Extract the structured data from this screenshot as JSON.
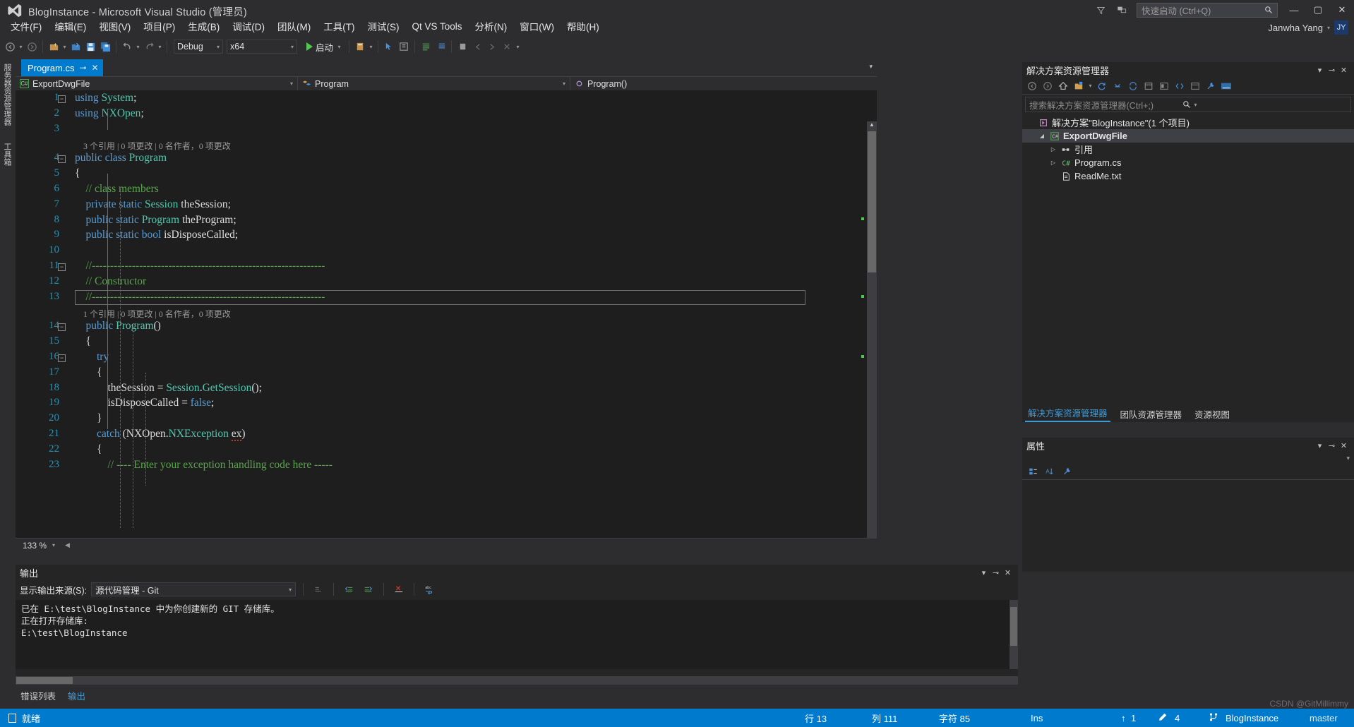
{
  "titlebar": {
    "title": "BlogInstance - Microsoft Visual Studio (管理员)",
    "quick_launch_placeholder": "快速启动 (Ctrl+Q)",
    "filter_icon": "funnel-icon",
    "feedback_icon": "feedback-icon",
    "search_icon": "search-icon",
    "minimize": "—",
    "maximize": "▢",
    "close": "✕",
    "account_name": "Janwha Yang",
    "account_caret": "▾",
    "avatar_initials": "JY"
  },
  "menubar": {
    "items": [
      {
        "label": "文件(F)"
      },
      {
        "label": "编辑(E)"
      },
      {
        "label": "视图(V)"
      },
      {
        "label": "项目(P)"
      },
      {
        "label": "生成(B)"
      },
      {
        "label": "调试(D)"
      },
      {
        "label": "团队(M)"
      },
      {
        "label": "工具(T)"
      },
      {
        "label": "测试(S)"
      },
      {
        "label": "Qt VS Tools"
      },
      {
        "label": "分析(N)"
      },
      {
        "label": "窗口(W)"
      },
      {
        "label": "帮助(H)"
      }
    ]
  },
  "toolbar": {
    "configuration": "Debug",
    "platform": "x64",
    "start_label": "启动",
    "caret": "▾"
  },
  "left_tabs": [
    {
      "label": "服务器资源管理器"
    },
    {
      "label": "工具箱"
    }
  ],
  "editor": {
    "tab": {
      "name": "Program.cs",
      "pin": "⊸",
      "close": "✕"
    },
    "breadcrumbs": {
      "project": "ExportDwgFile",
      "type": "Program",
      "member": "Program()",
      "caret": "▾"
    },
    "zoom_level": "133 %",
    "lines": [
      {
        "n": 1,
        "fold": "−",
        "text": "using System;"
      },
      {
        "n": 2,
        "fold": "",
        "text": "using NXOpen;"
      },
      {
        "n": 3,
        "fold": "",
        "text": ""
      },
      {
        "n": 4,
        "fold": "−",
        "text": "public class Program"
      },
      {
        "n": 5,
        "fold": "",
        "text": "{"
      },
      {
        "n": 6,
        "fold": "",
        "text": "    // class members"
      },
      {
        "n": 7,
        "fold": "",
        "text": "    private static Session theSession;"
      },
      {
        "n": 8,
        "fold": "",
        "text": "    public static Program theProgram;"
      },
      {
        "n": 9,
        "fold": "",
        "text": "    public static bool isDisposeCalled;"
      },
      {
        "n": 10,
        "fold": "",
        "text": ""
      },
      {
        "n": 11,
        "fold": "−",
        "text": "    //----------------------------------------------------------------"
      },
      {
        "n": 12,
        "fold": "",
        "text": "    // Constructor"
      },
      {
        "n": 13,
        "fold": "",
        "text": "    //----------------------------------------------------------------"
      },
      {
        "n": 14,
        "fold": "−",
        "text": "    public Program()"
      },
      {
        "n": 15,
        "fold": "",
        "text": "    {"
      },
      {
        "n": 16,
        "fold": "−",
        "text": "        try"
      },
      {
        "n": 17,
        "fold": "",
        "text": "        {"
      },
      {
        "n": 18,
        "fold": "",
        "text": "            theSession = Session.GetSession();"
      },
      {
        "n": 19,
        "fold": "",
        "text": "            isDisposeCalled = false;"
      },
      {
        "n": 20,
        "fold": "",
        "text": "        }"
      },
      {
        "n": 21,
        "fold": "",
        "text": "        catch (NXOpen.NXException ex)"
      },
      {
        "n": 22,
        "fold": "",
        "text": "        {"
      },
      {
        "n": 23,
        "fold": "",
        "text": "            // ---- Enter your exception handling code here -----"
      }
    ],
    "codelens": [
      {
        "after_line": 3,
        "text": "3 个引用 | 0 项更改 | 0 名作者，0 项更改"
      },
      {
        "after_line": 13,
        "text": "1 个引用 | 0 项更改 | 0 名作者，0 项更改"
      }
    ],
    "current_line": 13
  },
  "solution_explorer": {
    "title": "解决方案资源管理器",
    "caret_icon": "chevron-down-icon",
    "pin_icon": "pin-icon",
    "close_icon": "close-icon",
    "search_placeholder": "搜索解决方案资源管理器(Ctrl+;)",
    "search_icon": "search-icon",
    "search_caret": "▾",
    "toolbar_icons": [
      "back-icon",
      "forward-icon",
      "home-icon",
      "show-all-files-icon",
      "caret-icon",
      "refresh-icon",
      "collapse-all-icon",
      "sync-icon",
      "properties-icon",
      "preview-icon",
      "code-view-icon",
      "designer-icon",
      "wrench-icon",
      "pending-changes-icon"
    ],
    "tree": [
      {
        "indent": 0,
        "arrow": "",
        "icon": "solution-icon",
        "label": "解决方案\"BlogInstance\"(1 个项目)",
        "bold": false
      },
      {
        "indent": 1,
        "arrow": "◢",
        "icon": "csharp-project-icon",
        "label": "ExportDwgFile",
        "bold": true
      },
      {
        "indent": 2,
        "arrow": "▷",
        "icon": "references-icon",
        "label": "引用",
        "bold": false
      },
      {
        "indent": 2,
        "arrow": "▷",
        "icon": "csharp-file-icon",
        "label": "Program.cs",
        "bold": false
      },
      {
        "indent": 2,
        "arrow": "",
        "icon": "text-file-icon",
        "label": "ReadMe.txt",
        "bold": false
      }
    ],
    "tabs": [
      {
        "label": "解决方案资源管理器",
        "active": true
      },
      {
        "label": "团队资源管理器",
        "active": false
      },
      {
        "label": "资源视图",
        "active": false
      }
    ]
  },
  "properties": {
    "title": "属性",
    "caret_icon": "chevron-down-icon",
    "pin_icon": "pin-icon",
    "close_icon": "close-icon",
    "toolbar_icons": [
      "categorized-icon",
      "alphabetical-icon",
      "events-icon"
    ]
  },
  "output": {
    "title": "输出",
    "caret_icon": "chevron-down-icon",
    "pin_icon": "pin-icon",
    "close_icon": "close-icon",
    "source_label": "显示输出来源(S):",
    "source_value": "源代码管理 - Git",
    "source_caret": "▾",
    "toolbar_icons": [
      "clear-all-icon",
      "jump-prev-icon",
      "jump-next-icon",
      "clear-icon",
      "wrap-text-icon"
    ],
    "lines": [
      "已在 E:\\test\\BlogInstance 中为你创建新的 GIT 存储库。",
      "正在打开存储库:",
      "E:\\test\\BlogInstance"
    ]
  },
  "bottom_tabs": [
    {
      "label": "错误列表",
      "active": false
    },
    {
      "label": "输出",
      "active": true
    }
  ],
  "status_bar": {
    "ready": "就绪",
    "ready_icon": "flag-icon",
    "line_label": "行 13",
    "col_label": "列 111",
    "char_label": "字符 85",
    "insert_mode": "Ins",
    "up_arrow": "↑",
    "up_count": "1",
    "pencil_icon": "pencil-icon",
    "pencil_count": "4",
    "branch_icon": "branch-icon",
    "branch_name": "BlogInstance",
    "publish_label": "master"
  },
  "watermark": "CSDN @GitMillimmy",
  "colors": {
    "accent": "#007acc",
    "chrome": "#2d2d30",
    "panel": "#252526",
    "editor_bg": "#1e1e1e",
    "keyword": "#569cd6",
    "type": "#4ec9b0",
    "comment": "#57a64a",
    "linenum": "#2b91af"
  }
}
